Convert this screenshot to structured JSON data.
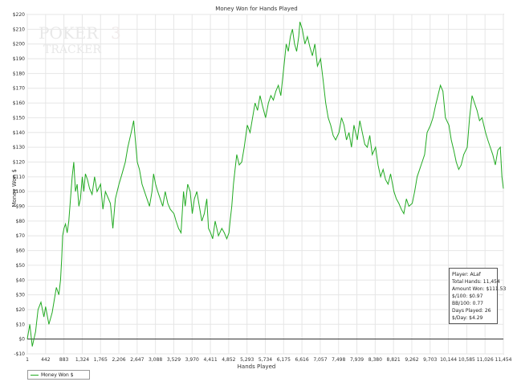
{
  "chart_data": {
    "type": "line",
    "title": "Money Won for Hands Played",
    "xlabel": "Hands Played",
    "ylabel": "Money Won $",
    "xlim": [
      1,
      11454
    ],
    "ylim": [
      -10,
      220
    ],
    "x_ticks": [
      "1",
      "442",
      "883",
      "1,324",
      "1,765",
      "2,206",
      "2,647",
      "3,088",
      "3,529",
      "3,970",
      "4,411",
      "4,852",
      "5,293",
      "5,734",
      "6,175",
      "6,616",
      "7,057",
      "7,498",
      "7,939",
      "8,380",
      "8,821",
      "9,262",
      "9,703",
      "10,144",
      "10,585",
      "11,026",
      "11,454"
    ],
    "y_ticks": [
      "-$10",
      "$0",
      "$10",
      "$20",
      "$30",
      "$40",
      "$50",
      "$60",
      "$70",
      "$80",
      "$90",
      "$100",
      "$110",
      "$120",
      "$130",
      "$140",
      "$150",
      "$160",
      "$170",
      "$180",
      "$190",
      "$200",
      "$210",
      "$220"
    ],
    "grid": true,
    "legend_position": "bottom-left",
    "series": [
      {
        "name": "Money Won $",
        "color": "#22aa22",
        "x": [
          1,
          60,
          120,
          200,
          260,
          330,
          400,
          442,
          520,
          600,
          700,
          760,
          800,
          830,
          850,
          883,
          920,
          960,
          1000,
          1040,
          1080,
          1120,
          1160,
          1200,
          1240,
          1280,
          1324,
          1360,
          1400,
          1450,
          1500,
          1560,
          1620,
          1680,
          1765,
          1820,
          1880,
          1940,
          2000,
          2060,
          2120,
          2206,
          2280,
          2360,
          2420,
          2500,
          2560,
          2600,
          2647,
          2700,
          2760,
          2820,
          2880,
          2940,
          3000,
          3040,
          3088,
          3140,
          3200,
          3260,
          3320,
          3380,
          3440,
          3529,
          3580,
          3640,
          3700,
          3760,
          3800,
          3860,
          3920,
          3970,
          4020,
          4080,
          4140,
          4200,
          4260,
          4320,
          4360,
          4411,
          4460,
          4520,
          4600,
          4680,
          4740,
          4800,
          4852,
          4880,
          4920,
          4960,
          5000,
          5040,
          5100,
          5160,
          5220,
          5293,
          5360,
          5420,
          5480,
          5540,
          5600,
          5660,
          5734,
          5800,
          5860,
          5920,
          5980,
          6040,
          6100,
          6175,
          6230,
          6280,
          6330,
          6380,
          6430,
          6480,
          6530,
          6560,
          6616,
          6680,
          6740,
          6800,
          6860,
          6920,
          6980,
          7057,
          7120,
          7180,
          7240,
          7300,
          7360,
          7420,
          7498,
          7560,
          7620,
          7680,
          7740,
          7800,
          7860,
          7939,
          8000,
          8060,
          8120,
          8180,
          8240,
          8300,
          8380,
          8440,
          8500,
          8560,
          8620,
          8680,
          8740,
          8821,
          8880,
          8940,
          9000,
          9060,
          9120,
          9180,
          9262,
          9320,
          9380,
          9440,
          9500,
          9560,
          9620,
          9703,
          9760,
          9820,
          9880,
          9940,
          10000,
          10060,
          10144,
          10200,
          10260,
          10320,
          10380,
          10440,
          10500,
          10585,
          10640,
          10700,
          10760,
          10820,
          10880,
          10940,
          11026,
          11080,
          11140,
          11200,
          11260,
          11320,
          11380,
          11420,
          11454
        ],
        "y": [
          0,
          10,
          -5,
          5,
          20,
          25,
          15,
          22,
          10,
          18,
          35,
          30,
          40,
          55,
          70,
          75,
          78,
          72,
          80,
          95,
          110,
          120,
          100,
          105,
          90,
          95,
          110,
          100,
          112,
          108,
          102,
          98,
          110,
          100,
          105,
          88,
          100,
          96,
          92,
          75,
          95,
          105,
          112,
          120,
          130,
          140,
          148,
          135,
          120,
          115,
          105,
          100,
          95,
          90,
          100,
          112,
          105,
          100,
          95,
          90,
          100,
          92,
          88,
          85,
          80,
          75,
          72,
          100,
          90,
          105,
          100,
          85,
          95,
          100,
          90,
          80,
          85,
          95,
          75,
          72,
          68,
          80,
          70,
          75,
          72,
          68,
          72,
          80,
          90,
          105,
          115,
          125,
          118,
          120,
          130,
          145,
          140,
          150,
          160,
          155,
          165,
          158,
          150,
          160,
          165,
          162,
          168,
          172,
          165,
          185,
          200,
          195,
          205,
          210,
          200,
          195,
          205,
          215,
          210,
          200,
          205,
          198,
          192,
          200,
          185,
          190,
          175,
          160,
          150,
          145,
          138,
          135,
          140,
          150,
          145,
          135,
          140,
          130,
          145,
          135,
          148,
          140,
          132,
          130,
          138,
          125,
          130,
          118,
          110,
          115,
          108,
          105,
          112,
          100,
          95,
          92,
          88,
          85,
          95,
          90,
          92,
          100,
          110,
          115,
          120,
          125,
          140,
          145,
          150,
          158,
          165,
          172,
          168,
          150,
          145,
          135,
          128,
          120,
          115,
          118,
          125,
          130,
          150,
          165,
          160,
          155,
          148,
          150,
          140,
          135,
          130,
          125,
          118,
          128,
          130,
          110,
          102
        ]
      }
    ]
  },
  "stats": {
    "player": "Player: ALaf",
    "total_hands": "Total Hands: 11,454",
    "amount_won": "Amount Won: $111.53",
    "per_100": "$/100: $0.97",
    "bb_100": "BB/100: 0.77",
    "days_played": "Days Played: 26",
    "per_day": "$/Day: $4.29"
  },
  "watermark": {
    "line1": "POKER",
    "line2": "TRACKER"
  }
}
